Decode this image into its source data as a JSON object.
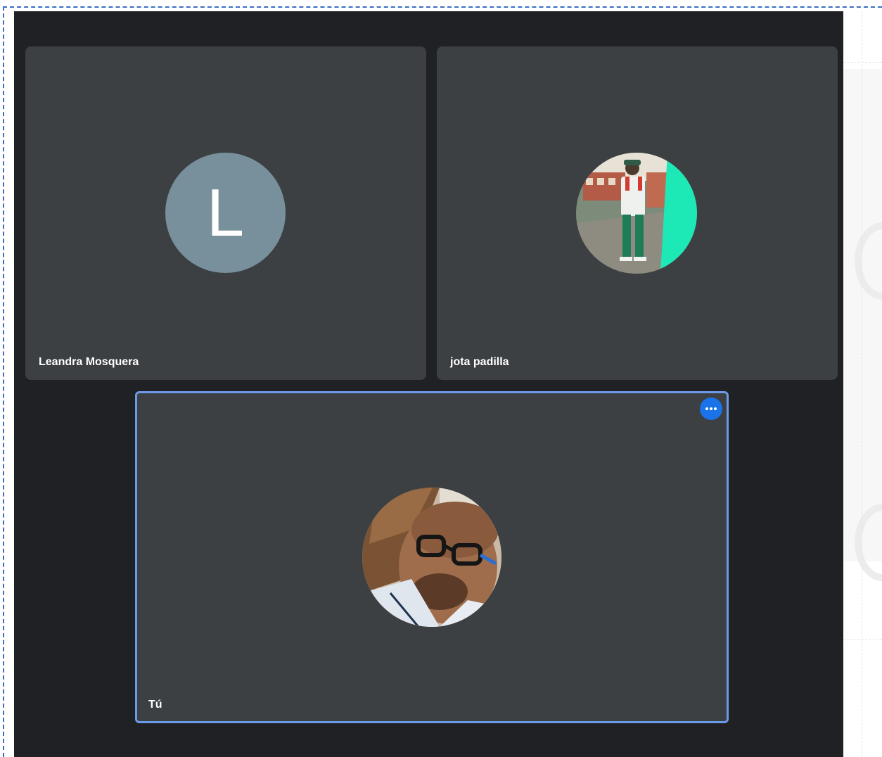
{
  "participants": [
    {
      "name": "Leandra Mosquera",
      "avatar_type": "letter",
      "avatar_letter": "L",
      "avatar_color": "#78909c"
    },
    {
      "name": "jota padilla",
      "avatar_type": "photo"
    },
    {
      "name": "Tú",
      "avatar_type": "photo",
      "active_speaker": true
    }
  ],
  "icons": {
    "more_options": "more-horizontal-icon"
  },
  "colors": {
    "stage_background": "#202124",
    "tile_background": "#3c4043",
    "highlight_border": "#6b9ae6",
    "more_button": "#1a73e8"
  }
}
